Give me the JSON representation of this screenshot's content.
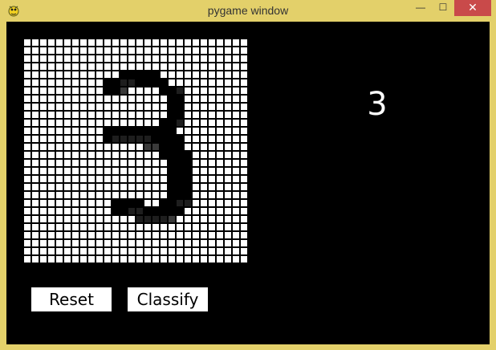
{
  "window": {
    "title": "pygame window",
    "minimize_glyph": "—",
    "maximize_glyph": "☐",
    "close_glyph": "✕"
  },
  "colors": {
    "frame": "#e3d06a",
    "background": "#000000",
    "cell_empty": "#ffffff",
    "ink": [
      "#000000",
      "#1e1e1e",
      "#3a3a3a"
    ]
  },
  "canvas": {
    "rows": 28,
    "cols": 28,
    "strokes": [
      {
        "row": 4,
        "cols": [
          [
            12,
            16,
            0
          ]
        ]
      },
      {
        "row": 5,
        "cols": [
          [
            10,
            11,
            0
          ],
          [
            12,
            13,
            1
          ],
          [
            14,
            17,
            0
          ]
        ]
      },
      {
        "row": 6,
        "cols": [
          [
            10,
            11,
            0
          ],
          [
            12,
            12,
            2
          ],
          [
            17,
            18,
            0
          ],
          [
            19,
            19,
            1
          ]
        ]
      },
      {
        "row": 7,
        "cols": [
          [
            18,
            19,
            0
          ]
        ]
      },
      {
        "row": 8,
        "cols": [
          [
            18,
            19,
            0
          ]
        ]
      },
      {
        "row": 9,
        "cols": [
          [
            18,
            19,
            0
          ]
        ]
      },
      {
        "row": 10,
        "cols": [
          [
            17,
            18,
            0
          ],
          [
            19,
            19,
            1
          ]
        ]
      },
      {
        "row": 11,
        "cols": [
          [
            10,
            18,
            0
          ]
        ]
      },
      {
        "row": 12,
        "cols": [
          [
            10,
            10,
            0
          ],
          [
            11,
            15,
            1
          ],
          [
            16,
            19,
            0
          ]
        ]
      },
      {
        "row": 13,
        "cols": [
          [
            15,
            16,
            2
          ],
          [
            17,
            19,
            0
          ]
        ]
      },
      {
        "row": 14,
        "cols": [
          [
            17,
            20,
            0
          ]
        ]
      },
      {
        "row": 15,
        "cols": [
          [
            18,
            20,
            0
          ]
        ]
      },
      {
        "row": 16,
        "cols": [
          [
            18,
            20,
            0
          ]
        ]
      },
      {
        "row": 17,
        "cols": [
          [
            18,
            20,
            0
          ]
        ]
      },
      {
        "row": 18,
        "cols": [
          [
            18,
            20,
            0
          ]
        ]
      },
      {
        "row": 19,
        "cols": [
          [
            18,
            20,
            0
          ]
        ]
      },
      {
        "row": 20,
        "cols": [
          [
            11,
            14,
            0
          ],
          [
            17,
            18,
            0
          ],
          [
            19,
            20,
            1
          ]
        ]
      },
      {
        "row": 21,
        "cols": [
          [
            11,
            12,
            0
          ],
          [
            13,
            14,
            1
          ],
          [
            15,
            19,
            0
          ]
        ]
      },
      {
        "row": 22,
        "cols": [
          [
            14,
            17,
            1
          ],
          [
            18,
            18,
            2
          ]
        ]
      }
    ]
  },
  "prediction": "3",
  "buttons": {
    "reset": "Reset",
    "classify": "Classify"
  }
}
